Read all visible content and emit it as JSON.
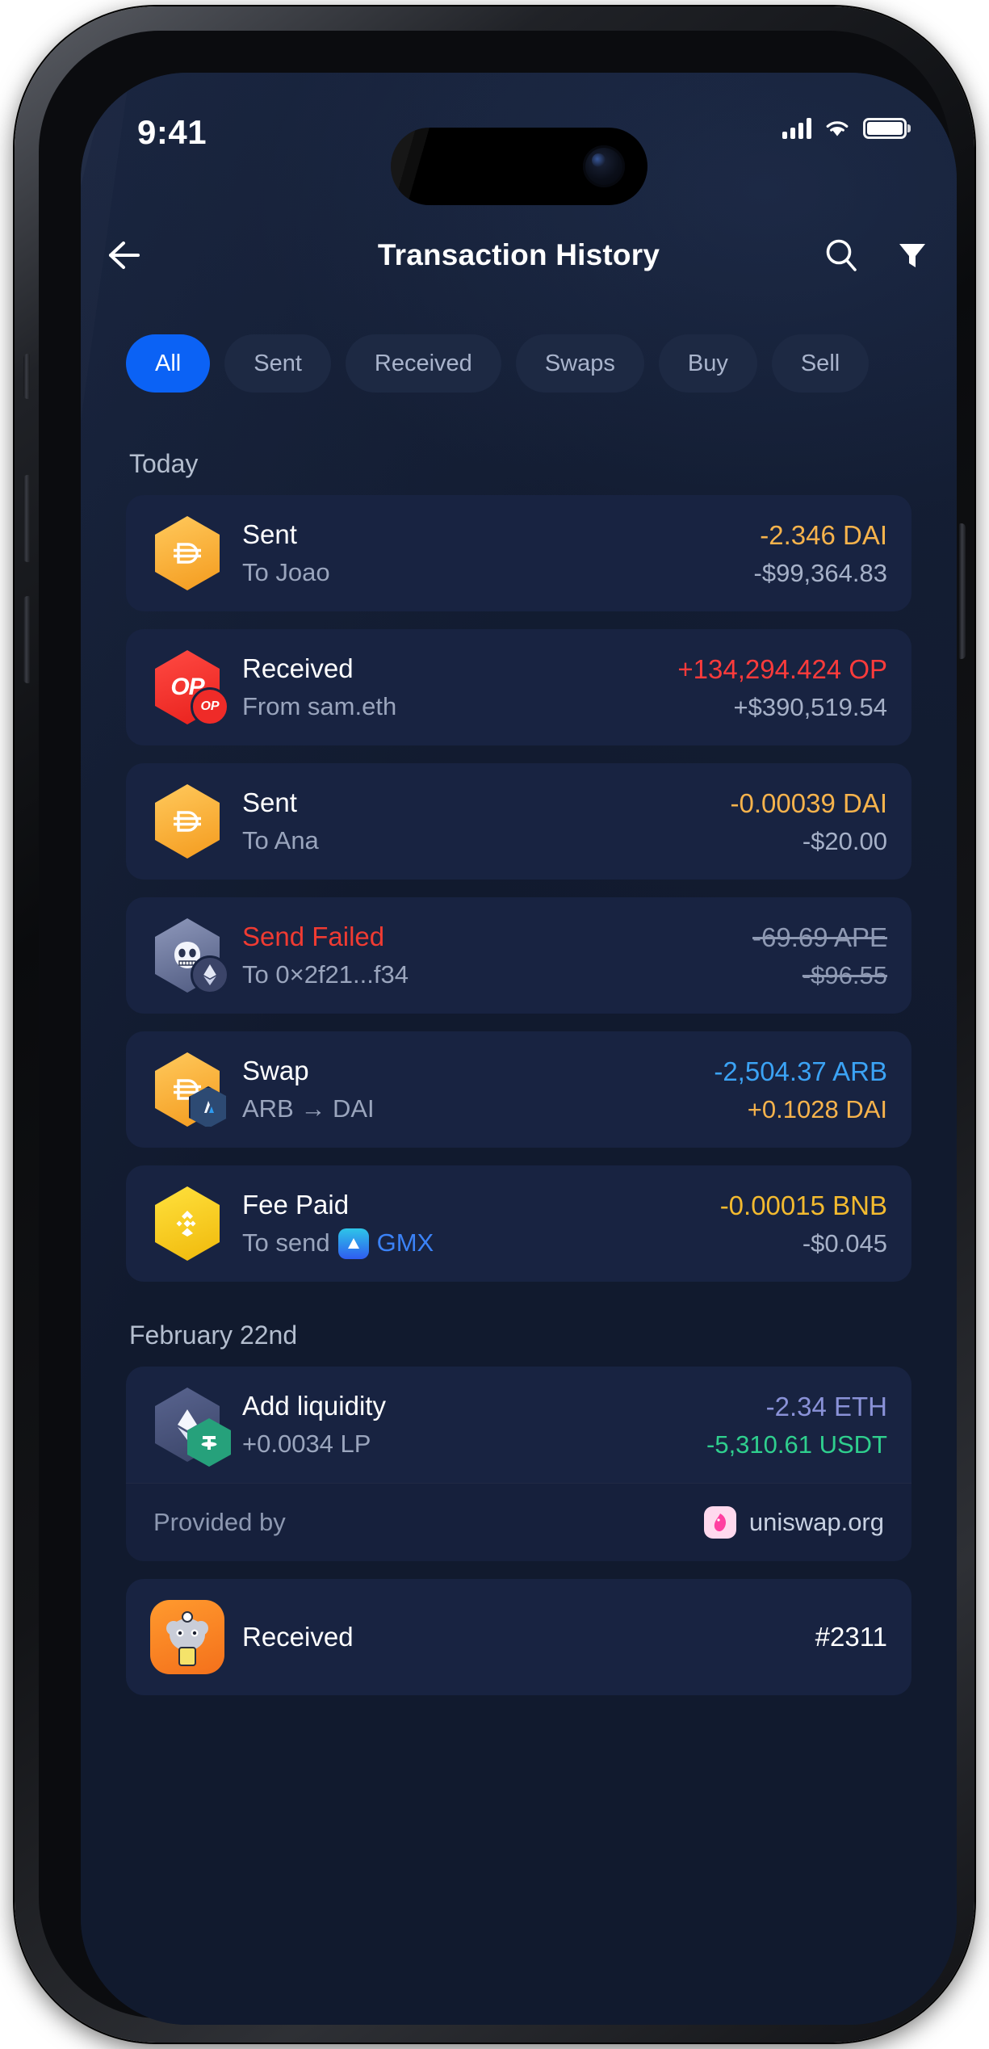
{
  "status_bar": {
    "time": "9:41",
    "signal_icon": "cellular-signal-icon",
    "wifi_icon": "wifi-icon",
    "battery_icon": "battery-full-icon"
  },
  "header": {
    "back_icon": "back-arrow-icon",
    "title": "Transaction History",
    "search_icon": "search-icon",
    "filter_icon": "filter-funnel-icon"
  },
  "filters": {
    "active": "All",
    "chips": [
      {
        "label": "All",
        "active": true
      },
      {
        "label": "Sent",
        "active": false
      },
      {
        "label": "Received",
        "active": false
      },
      {
        "label": "Swaps",
        "active": false
      },
      {
        "label": "Buy",
        "active": false
      },
      {
        "label": "Sell",
        "active": false
      }
    ]
  },
  "colors": {
    "accent_blue": "#0b62f5",
    "screen_bg": "#111a2e",
    "card_bg": "#182341",
    "dai_orange": "#f7b34c",
    "op_red": "#fc3b3b",
    "arb_blue": "#3ba3f5",
    "bnb_yellow": "#f3ba2f",
    "eth_purple": "#8a92d8",
    "usdt_green": "#26a17b",
    "failed_red": "#f03b32",
    "muted_text": "#9aa5bd"
  },
  "groups": [
    {
      "label": "Today",
      "items": [
        {
          "kind": "sent",
          "icon": "dai-token-icon",
          "title": "Sent",
          "subtitle": "To Joao",
          "amount": "-2.346 DAI",
          "amount_color": "#f7b34c",
          "fiat": "-$99,364.83",
          "fiat_color": "#a6b1c8",
          "failed": false
        },
        {
          "kind": "received",
          "icon": "optimism-token-icon",
          "icon_badge": "optimism-badge-icon",
          "title": "Received",
          "subtitle": "From sam.eth",
          "amount": "+134,294.424 OP",
          "amount_color": "#fc3b3b",
          "fiat": "+$390,519.54",
          "fiat_color": "#a6b1c8",
          "failed": false
        },
        {
          "kind": "sent",
          "icon": "dai-token-icon",
          "title": "Sent",
          "subtitle": "To Ana",
          "amount": "-0.00039 DAI",
          "amount_color": "#f7b34c",
          "fiat": "-$20.00",
          "fiat_color": "#a6b1c8",
          "failed": false
        },
        {
          "kind": "failed",
          "icon": "apecoin-nft-icon",
          "icon_badge": "ethereum-badge-icon",
          "title": "Send Failed",
          "subtitle": "To 0×2f21...f34",
          "amount": "-69.69 APE",
          "amount_color": "#8e99b3",
          "fiat": "-$96.55",
          "fiat_color": "#8e99b3",
          "failed": true
        },
        {
          "kind": "swap",
          "icon": "dai-token-icon",
          "icon_badge": "arbitrum-badge-icon",
          "title": "Swap",
          "subtitle": "ARB → DAI",
          "amount": "-2,504.37 ARB",
          "amount_color": "#3ba3f5",
          "fiat": "+0.1028 DAI",
          "fiat_color": "#f7b34c",
          "failed": false
        },
        {
          "kind": "fee",
          "icon": "bnb-token-icon",
          "title": "Fee Paid",
          "subtitle_prefix": "To send",
          "subtitle_app_icon": "gmx-app-icon",
          "subtitle_app": "GMX",
          "amount": "-0.00015 BNB",
          "amount_color": "#f3ba2f",
          "fiat": "-$0.045",
          "fiat_color": "#a6b1c8",
          "failed": false
        }
      ]
    },
    {
      "label": "February 22nd",
      "items": [
        {
          "kind": "liquidity",
          "icon": "ethereum-token-icon",
          "icon_badge": "tether-badge-icon",
          "title": "Add liquidity",
          "subtitle": "+0.0034 LP",
          "amount": "-2.34 ETH",
          "amount_color": "#8a92d8",
          "fiat": "-5,310.61 USDT",
          "fiat_color": "#2fcf8e",
          "failed": false,
          "provider": {
            "label": "Provided by",
            "logo_icon": "uniswap-logo-icon",
            "name": "uniswap.org"
          }
        },
        {
          "kind": "nft-received",
          "icon": "nft-avatar-icon",
          "title": "Received",
          "amount": "#2311",
          "amount_color": "#ffffff",
          "failed": false
        }
      ]
    }
  ]
}
